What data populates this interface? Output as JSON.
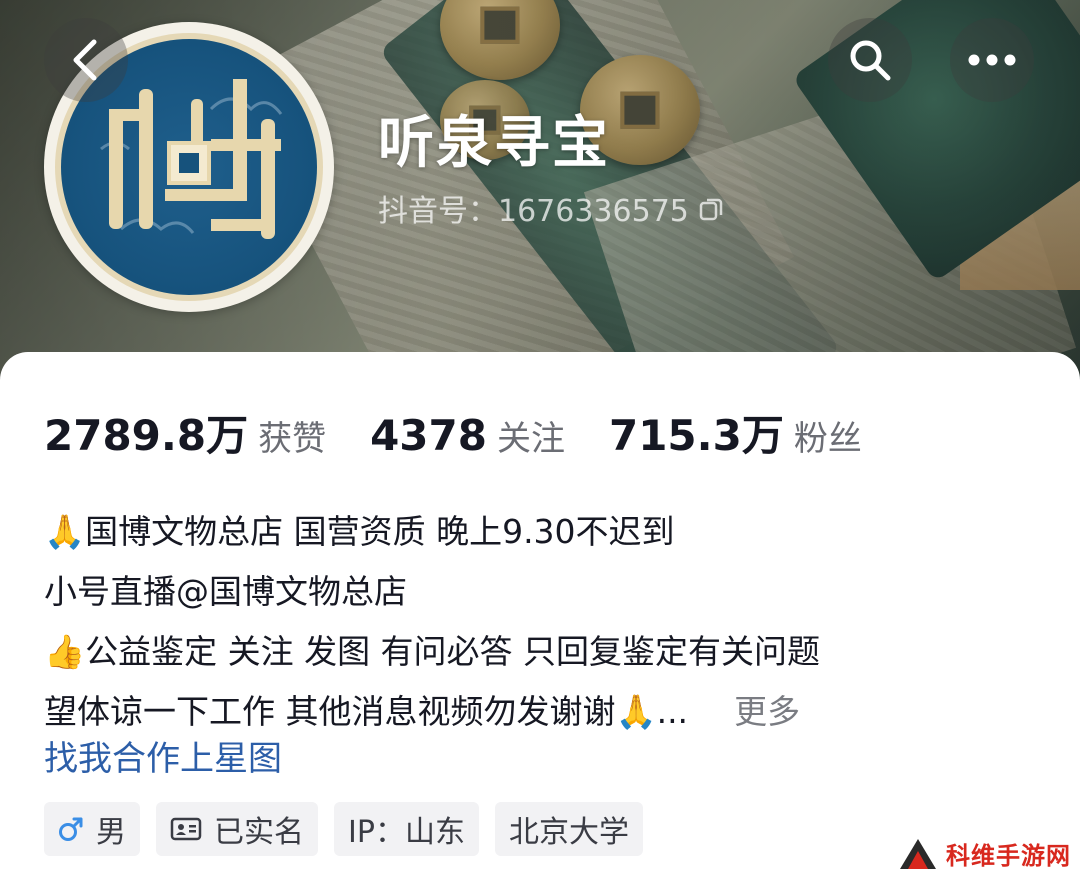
{
  "header": {
    "account_name": "听泉寻宝",
    "douyin_id_text": "抖音号：1676336575",
    "back_icon": "chevron-left-icon",
    "search_icon": "search-icon",
    "more_icon": "more-dots-icon"
  },
  "avatar": {
    "logo_text": "听泉"
  },
  "stats": {
    "likes_value": "2789.8万",
    "likes_label": "获赞",
    "following_value": "4378",
    "following_label": "关注",
    "followers_value": "715.3万",
    "followers_label": "粉丝"
  },
  "bio": {
    "line1": "🙏国博文物总店 国营资质 晚上9.30不迟到",
    "line2": "小号直播@国博文物总店",
    "line3": "👍公益鉴定 关注 发图 有问必答 只回复鉴定有关问题",
    "line4": "望体谅一下工作 其他消息视频勿发谢谢🙏...",
    "more_label": "更多",
    "cooperation_link": "找我合作上星图"
  },
  "tags": [
    {
      "icon": "male-icon",
      "label": "男"
    },
    {
      "icon": "id-card-icon",
      "label": "已实名"
    },
    {
      "icon": "",
      "label": "IP：山东"
    },
    {
      "icon": "",
      "label": "北京大学"
    }
  ],
  "watermark": {
    "text": "科维手游网"
  },
  "colors": {
    "link": "#2c5ea8",
    "male": "#3a8ee6",
    "watermark": "#d8281e"
  }
}
